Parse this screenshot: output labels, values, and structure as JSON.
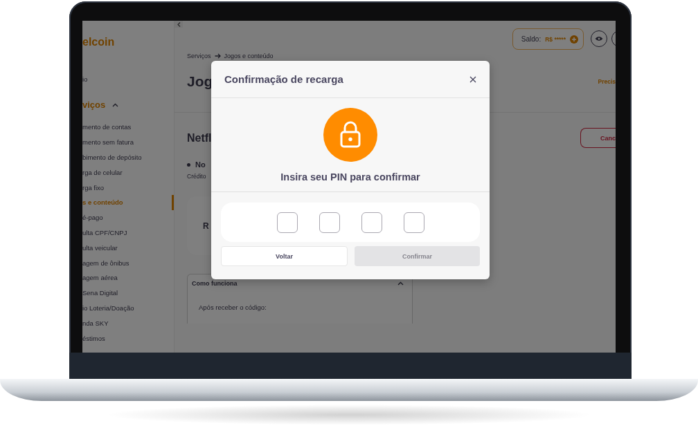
{
  "sidebar": {
    "logo": "elcoin",
    "home": "io",
    "section": {
      "label": "viços",
      "expanded": true
    },
    "items": [
      {
        "label": "mento de contas",
        "selected": false
      },
      {
        "label": "mento sem fatura",
        "selected": false
      },
      {
        "label": "bimento de depósito",
        "selected": false
      },
      {
        "label": "rga de celular",
        "selected": false
      },
      {
        "label": "rga fixo",
        "selected": false
      },
      {
        "label": "s e conteúdo",
        "selected": true
      },
      {
        "label": "é-pago",
        "selected": false
      },
      {
        "label": "ulta CPF/CNPJ",
        "selected": false
      },
      {
        "label": "ulta veicular",
        "selected": false
      },
      {
        "label": "agem de ônibus",
        "selected": false
      },
      {
        "label": "agem aérea",
        "selected": false
      },
      {
        "label": "Sena Digital",
        "selected": false
      },
      {
        "label": "io Loteria/Doação",
        "selected": false
      },
      {
        "label": "nda SKY",
        "selected": false
      },
      {
        "label": "éstimos",
        "selected": false
      }
    ]
  },
  "header": {
    "balance_label": "Saldo:",
    "balance_value": "R$ *****"
  },
  "breadcrumb": [
    "Serviços",
    "Jogos e conteúdo"
  ],
  "page": {
    "title": "Jog",
    "help_link": "Precis",
    "product": "Netfl",
    "cancel_button": "Canc",
    "bullet": "No",
    "note": "Crédito",
    "card_value": "R",
    "accordion": {
      "title": "Como funciona",
      "expanded": true,
      "text": "Após receber o código:"
    }
  },
  "modal": {
    "title": "Confirmação de recarga",
    "prompt": "Insira seu PIN para confirmar",
    "pin_fields": [
      {
        "filled": false
      },
      {
        "filled": false
      },
      {
        "filled": false
      },
      {
        "filled": false
      }
    ],
    "back_button": "Voltar",
    "confirm_button": {
      "label": "Confirmar",
      "disabled": true
    }
  }
}
